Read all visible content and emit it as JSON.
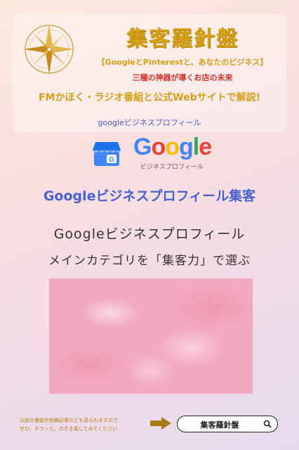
{
  "header": {
    "title": "集客羅針盤",
    "subtitle": "【GoogleとPinterestと、あなたのビジネス】",
    "tagline": "三種の神器が導くお店の未来",
    "explain": "FMかほく・ラジオ番組と公式Webサイトで解説!"
  },
  "gbp": {
    "small_label": "googleビジネスプロフィール",
    "logo_letters": [
      "G",
      "o",
      "o",
      "g",
      "l",
      "e"
    ],
    "logo_caption": "ビジネスプロフィール",
    "heading": "Googleビジネスプロフィール集客"
  },
  "main": {
    "title_line1": "Googleビジネスプロフィール",
    "title_line2": "メインカテゴリを「集客力」で選ぶ"
  },
  "footer": {
    "note_line1": "以前の番組や投稿記事なども見られますので",
    "note_line2": "ぜひ、チラッと、のぞき見してみてください",
    "search_label": "集客羅針盤"
  },
  "colors": {
    "gold": "#d4a017",
    "red": "#d8322a",
    "blue_heading": "#4a62d0",
    "cotton_pink": "#f2a9bf"
  }
}
